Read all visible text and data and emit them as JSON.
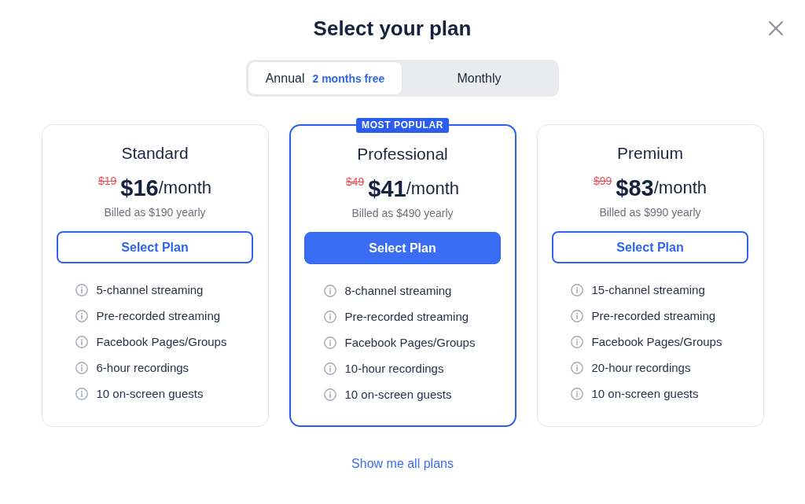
{
  "title": "Select your plan",
  "billing_toggle": [
    {
      "label": "Annual",
      "badge": "2 months free",
      "selected": true
    },
    {
      "label": "Monthly",
      "selected": false
    }
  ],
  "plans": [
    {
      "name": "Standard",
      "old_price": "$19",
      "price": "$16",
      "period": "/month",
      "billed": "Billed as $190 yearly",
      "button": "Select Plan",
      "highlighted": false,
      "features": [
        "5-channel streaming",
        "Pre-recorded streaming",
        "Facebook Pages/Groups",
        "6-hour recordings",
        "10 on-screen guests"
      ]
    },
    {
      "name": "Professional",
      "ribbon": "MOST POPULAR",
      "old_price": "$49",
      "price": "$41",
      "period": "/month",
      "billed": "Billed as $490 yearly",
      "button": "Select Plan",
      "highlighted": true,
      "features": [
        "8-channel streaming",
        "Pre-recorded streaming",
        "Facebook Pages/Groups",
        "10-hour recordings",
        "10 on-screen guests"
      ]
    },
    {
      "name": "Premium",
      "old_price": "$99",
      "price": "$83",
      "period": "/month",
      "billed": "Billed as $990 yearly",
      "button": "Select Plan",
      "highlighted": false,
      "features": [
        "15-channel streaming",
        "Pre-recorded streaming",
        "Facebook Pages/Groups",
        "20-hour recordings",
        "10 on-screen guests"
      ]
    }
  ],
  "footer_link": "Show me all plans"
}
